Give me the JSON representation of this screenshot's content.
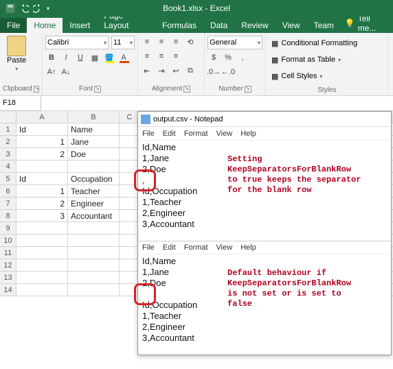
{
  "titlebar": {
    "title": "Book1.xlsx - Excel"
  },
  "tabs": {
    "file": "File",
    "home": "Home",
    "insert": "Insert",
    "pageLayout": "Page Layout",
    "formulas": "Formulas",
    "data": "Data",
    "review": "Review",
    "view": "View",
    "team": "Team",
    "tellMe": "Tell me..."
  },
  "ribbon": {
    "clipboard": {
      "paste": "Paste",
      "label": "Clipboard"
    },
    "font": {
      "name": "Calibri",
      "size": "11",
      "label": "Font",
      "bold": "B",
      "italic": "I",
      "underline": "U"
    },
    "alignment": {
      "label": "Alignment"
    },
    "number": {
      "format": "General",
      "label": "Number"
    },
    "styles": {
      "conditional": "Conditional Formatting",
      "table": "Format as Table",
      "cellStyles": "Cell Styles",
      "label": "Styles"
    }
  },
  "namebox": "F18",
  "columns": [
    "A",
    "B",
    "C"
  ],
  "rows": [
    {
      "n": "1",
      "a": "Id",
      "b": "Name",
      "c": ""
    },
    {
      "n": "2",
      "a": "1",
      "b": "Jane",
      "c": "",
      "numA": true
    },
    {
      "n": "3",
      "a": "2",
      "b": "Doe",
      "c": "",
      "numA": true
    },
    {
      "n": "4",
      "a": "",
      "b": "",
      "c": ""
    },
    {
      "n": "5",
      "a": "Id",
      "b": "Occupation",
      "c": ""
    },
    {
      "n": "6",
      "a": "1",
      "b": "Teacher",
      "c": "",
      "numA": true
    },
    {
      "n": "7",
      "a": "2",
      "b": "Engineer",
      "c": "",
      "numA": true
    },
    {
      "n": "8",
      "a": "3",
      "b": "Accountant",
      "c": "",
      "numA": true
    },
    {
      "n": "9",
      "a": "",
      "b": "",
      "c": ""
    },
    {
      "n": "10",
      "a": "",
      "b": "",
      "c": ""
    },
    {
      "n": "11",
      "a": "",
      "b": "",
      "c": ""
    },
    {
      "n": "12",
      "a": "",
      "b": "",
      "c": ""
    },
    {
      "n": "13",
      "a": "",
      "b": "",
      "c": ""
    },
    {
      "n": "14",
      "a": "",
      "b": "",
      "c": ""
    }
  ],
  "notepad": {
    "title": "output.csv - Notepad",
    "menu": [
      "File",
      "Edit",
      "Format",
      "View",
      "Help"
    ],
    "block1": [
      "Id,Name",
      "1,Jane",
      "2,Doe",
      ",",
      "Id,Occupation",
      "1,Teacher",
      "2,Engineer",
      "3,Accountant"
    ],
    "block2": [
      "Id,Name",
      "1,Jane",
      "2,Doe",
      "",
      "Id,Occupation",
      "1,Teacher",
      "2,Engineer",
      "3,Accountant"
    ],
    "annotation1": [
      "Setting",
      "KeepSeparatorsForBlankRow",
      "to true keeps the separator",
      "for the blank row"
    ],
    "annotation2": [
      "Default behaviour if",
      "KeepSeparatorsForBlankRow",
      "is not set or is set to",
      "false"
    ]
  }
}
